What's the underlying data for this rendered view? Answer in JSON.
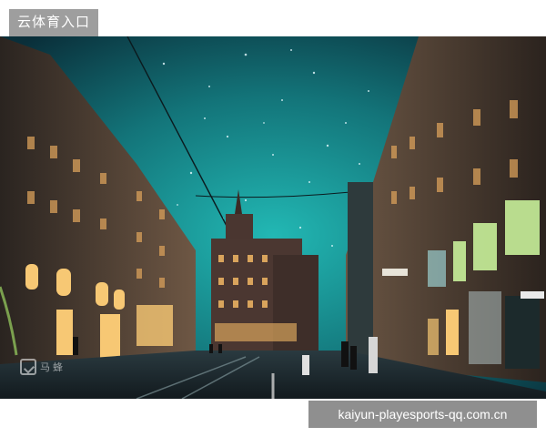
{
  "header": {
    "title": "云体育入口"
  },
  "photo": {
    "subject": "city-street-night",
    "watermark_icon": "image-icon",
    "watermark_text": "马 蜂"
  },
  "footer": {
    "url_text": "kaiyun-playesports-qq.com.cn"
  },
  "colors": {
    "sky_teal": "#1aa6a8",
    "sky_dark": "#0d3b44",
    "lamp_warm": "#f5c56a",
    "badge_gray": "#9e9e9e",
    "url_badge_gray": "#8f8f8f"
  }
}
